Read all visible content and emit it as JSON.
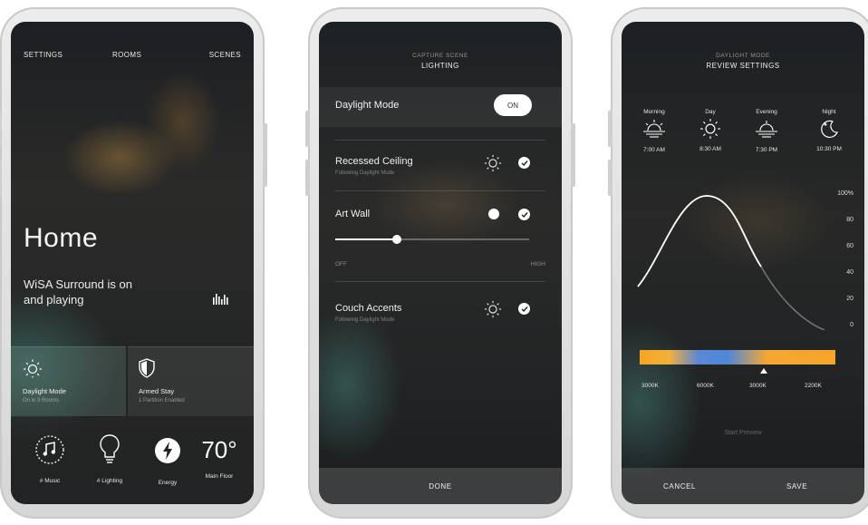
{
  "screen1": {
    "nav": [
      "SETTINGS",
      "ROOMS",
      "SCENES"
    ],
    "title": "Home",
    "status_line1": "WiSA Surround is on",
    "status_line2": "and playing",
    "tiles": [
      {
        "label": "Daylight Mode",
        "sub": "On in 3 Rooms"
      },
      {
        "label": "Armed Stay",
        "sub": "1 Partition Enabled"
      }
    ],
    "bottom": [
      {
        "label": "# Music"
      },
      {
        "label": "# Lighting"
      },
      {
        "label": "Energy"
      },
      {
        "label": "Main Floor",
        "value": "70°"
      }
    ]
  },
  "screen2": {
    "header_small": "CAPTURE SCENE",
    "header": "LIGHTING",
    "daylight_label": "Daylight Mode",
    "toggle_label": "ON",
    "rows": [
      {
        "label": "Recessed Ceiling",
        "sub": "Following Daylight Mode"
      },
      {
        "label": "Art Wall",
        "sub": ""
      },
      {
        "label": "Couch Accents",
        "sub": "Following Daylight Mode"
      }
    ],
    "slider": {
      "value": 0.32,
      "min_label": "OFF",
      "max_label": "HIGH"
    },
    "done_label": "DONE"
  },
  "screen3": {
    "header_small": "DAYLIGHT MODE",
    "header": "REVIEW SETTINGS",
    "periods": [
      {
        "name": "Morning",
        "time": "7:00 AM",
        "icon": "sunrise-icon"
      },
      {
        "name": "Day",
        "time": "8:30 AM",
        "icon": "sun-icon"
      },
      {
        "name": "Evening",
        "time": "7:30 PM",
        "icon": "sunset-icon"
      },
      {
        "name": "Night",
        "time": "10:30 PM",
        "icon": "moon-icon"
      }
    ],
    "y_axis": [
      "100%",
      "80",
      "60",
      "40",
      "20",
      "0"
    ],
    "temps": [
      "3000K",
      "6000K",
      "3000K",
      "2200K"
    ],
    "preview_label": "Start Preview",
    "cancel_label": "CANCEL",
    "save_label": "SAVE"
  },
  "colors": {
    "accent_orange": "#f7a428",
    "accent_blue": "#4f86d8"
  }
}
